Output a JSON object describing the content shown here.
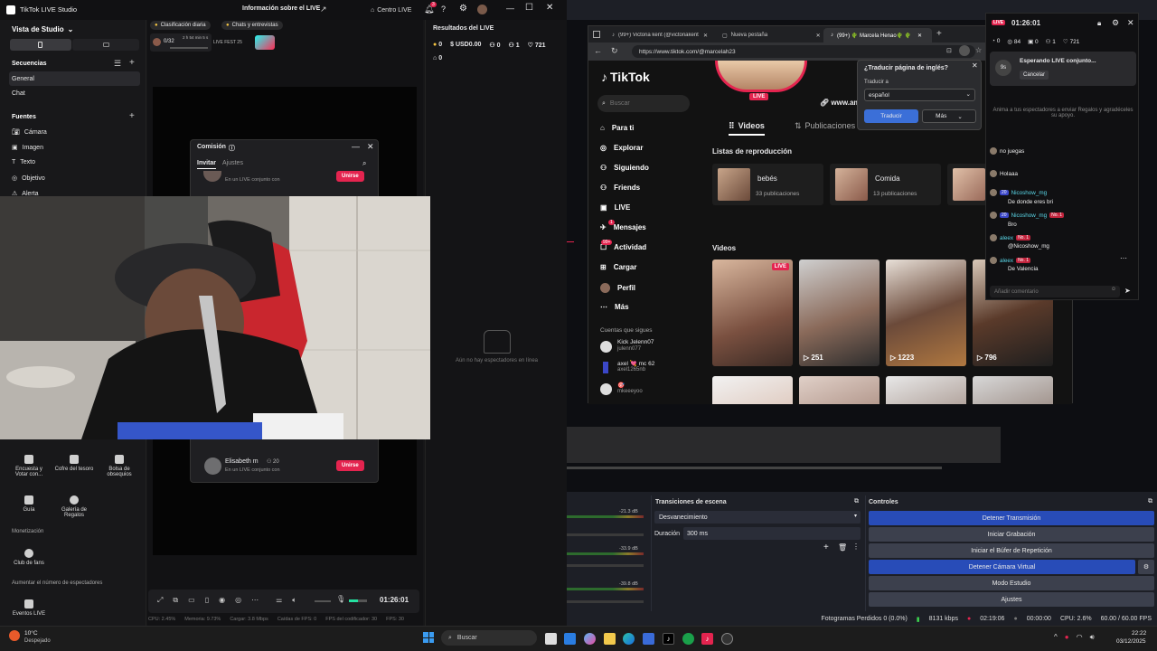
{
  "studio": {
    "app_title": "TikTok LIVE Studio",
    "live_info": "Información sobre el LIVE",
    "control_center": "Centro LIVE",
    "notif_count": "3",
    "view_mode": "Vista de Studio",
    "sequences": "Secuencias",
    "seq_items": [
      "General",
      "Chat"
    ],
    "sources": "Fuentes",
    "source_items": [
      "Cámara",
      "Imagen",
      "Texto",
      "Objetivo",
      "Alerta"
    ],
    "tools": [
      {
        "label": "Encuesta y Votar con..."
      },
      {
        "label": "Cofre del tesoro"
      },
      {
        "label": "Bolsa de obsequios"
      },
      {
        "label": "Guía"
      },
      {
        "label": "Galería de Regalos"
      }
    ],
    "monetization": "Monetización",
    "fan_club": "Club de fans",
    "increase_viewers": "Aumentar el número de espectadores",
    "live_events": "Eventos LIVE",
    "daily_rank": "Clasificación diaria",
    "chats": "Chats y entrevistas",
    "rank_progress": "0/32",
    "rank_time": "2 h 54 min 5 s",
    "fest_label": "LIVE FEST 25",
    "results_title": "Resultados del LIVE",
    "stats": {
      "coins": "0",
      "usd": "USD0.00",
      "viewers": "0",
      "follows": "1",
      "likes": "721",
      "gifts": "0"
    },
    "no_viewers": "Aún no hay espectadores en línea",
    "collab": {
      "title": "Comisión",
      "tab_invite": "Invitar",
      "tab_settings": "Ajustes",
      "top_sub": "En un LIVE conjunto con",
      "join": "Unirse",
      "user_name": "Elisabeth m",
      "user_badge": "20",
      "user_sub": "En un LIVE conjunto con"
    },
    "timer": "01:26:01",
    "bottom_stats": [
      "CPU: 2.45%",
      "Memoria: 9.73%",
      "Cargar: 3.8 Mbps",
      "Caídas de FPS: 0",
      "FPS del codificador: 30",
      "FPS: 30"
    ]
  },
  "browser": {
    "tabs": [
      "(99+) Victoria kent (@victoriakent",
      "Nueva pestaña",
      "(99+) 🌵 Marcela Henao🌵 🌵"
    ],
    "url": "https://www.tiktok.com/@marcelah23",
    "search_placeholder": "Buscar",
    "nav": [
      "Para ti",
      "Explorar",
      "Siguiendo",
      "Friends",
      "LIVE",
      "Mensajes",
      "Actividad",
      "Cargar",
      "Perfil",
      "Más"
    ],
    "msg_badge": "1",
    "activity_badge": "99+",
    "following_title": "Cuentas que sigues",
    "following": [
      {
        "name": "Kick Jelenn07",
        "handle": "julenn077"
      },
      {
        "name": "axel 💘 mc 62",
        "handle": "axel1265nb"
      },
      {
        "name": "🎯",
        "handle": "mkeeeyoo"
      }
    ],
    "profile_live": "LIVE",
    "profile_link": "www.am",
    "tab_videos": "Videos",
    "tab_posts": "Publicaciones",
    "playlists_title": "Listas de reproducción",
    "playlists": [
      {
        "name": "bebés",
        "count": "33 publicaciones"
      },
      {
        "name": "Comida",
        "count": "13 publicaciones"
      }
    ],
    "videos_title": "Videos",
    "videos": [
      "",
      "251",
      "1223",
      "796"
    ],
    "translate": {
      "title": "¿Traducir página de inglés?",
      "label": "Traducir a",
      "lang": "español",
      "ok": "Traducir",
      "more": "Más"
    }
  },
  "chat": {
    "timer": "01:26:01",
    "stats": [
      "0",
      "84",
      "0",
      "1",
      "721"
    ],
    "waiting": "Esperando LIVE conjunto...",
    "countdown": "9s",
    "cancel": "Cancelar",
    "tip": "Anima a tus espectadores a enviar Regalos y agradéceles su apoyo.",
    "lines": [
      {
        "user": "",
        "text": "no juegas"
      },
      {
        "user": "",
        "text": "Holaaa"
      },
      {
        "user": "Nicoshow_mg",
        "badge": "20",
        "text": "De donde eres bri"
      },
      {
        "user": "Nicoshow_mg",
        "badge": "20",
        "rank": "No. 1",
        "text": "Bro"
      },
      {
        "user": "aleex",
        "rank": "No. 1",
        "text": "@Nicoshow_mg"
      },
      {
        "user": "aleex",
        "rank": "No. 1",
        "text": "De Valencia"
      }
    ],
    "input_placeholder": "Añadir comentario"
  },
  "obs": {
    "transitions_title": "Transiciones de escena",
    "transition": "Desvanecimiento",
    "duration_label": "Duración",
    "duration_value": "300 ms",
    "controls_title": "Controles",
    "controls": [
      "Detener Transmisión",
      "Iniciar Grabación",
      "Iniciar el Búfer de Repetición",
      "Detener Cámara Virtual",
      "Modo Estudio",
      "Ajustes"
    ],
    "mixer_db": [
      "-21.3 dB",
      "-33.9 dB",
      "-39.8 dB"
    ],
    "status": [
      "Fotogramas Perdidos 0 (0.0%)",
      "8131 kbps",
      "02:19:06",
      "00:00:00",
      "CPU: 2.6%",
      "60.00 / 60.00 FPS"
    ]
  },
  "taskbar": {
    "temp": "10°C",
    "weather": "Despejado",
    "search": "Buscar",
    "time": "22:22",
    "date": "03/12/2025"
  },
  "colors": {
    "accent_red": "#e4244f",
    "obs_blue": "#284cb8",
    "tiktok_cyan": "#25f4ee"
  }
}
